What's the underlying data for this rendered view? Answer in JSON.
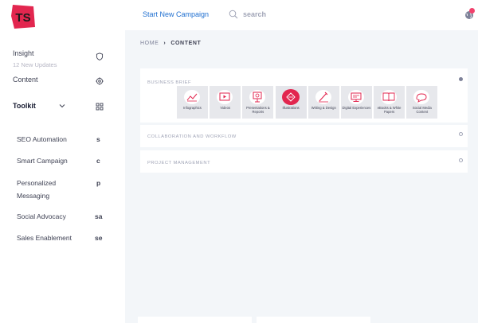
{
  "brand": {
    "logo_text": "TS",
    "logo_color": "#e2264f"
  },
  "topbar": {
    "start_campaign_label": "Start New Campaign",
    "search_placeholder": "search"
  },
  "sidebar": {
    "insight_label": "Insight",
    "insight_sub": "12 New Updates",
    "content_label": "Content",
    "toolkit_label": "Toolkit",
    "tools": [
      {
        "label": "SEO Automation",
        "abbr": "s"
      },
      {
        "label": "Smart Campaign",
        "abbr": "c"
      },
      {
        "label": "Personalized Messaging",
        "abbr": "p"
      },
      {
        "label": "Social Advocacy",
        "abbr": "sa"
      },
      {
        "label": "Sales Enablement",
        "abbr": "se"
      }
    ]
  },
  "breadcrumb": {
    "home": "HOME",
    "current": "CONTENT"
  },
  "panels": {
    "business_brief": "BUSINESS BRIEF",
    "collaboration": "COLLABORATION AND WORKFLOW",
    "project_management": "PROJECT MANAGEMENT"
  },
  "tiles": [
    {
      "label": "Infographics",
      "icon": "infographics-icon"
    },
    {
      "label": "Videos",
      "icon": "video-icon"
    },
    {
      "label": "Presentations & Reports",
      "icon": "presentation-icon"
    },
    {
      "label": "Illustrations",
      "icon": "illustration-icon"
    },
    {
      "label": "Writing & Design",
      "icon": "writing-icon"
    },
    {
      "label": "Digital Experiences",
      "icon": "digital-icon"
    },
    {
      "label": "eBooks & White Papers",
      "icon": "ebook-icon"
    },
    {
      "label": "Social Media Content",
      "icon": "social-media-icon"
    }
  ],
  "colors": {
    "accent": "#e2264f",
    "link": "#1f6fd0",
    "background": "#f3f6f9"
  }
}
